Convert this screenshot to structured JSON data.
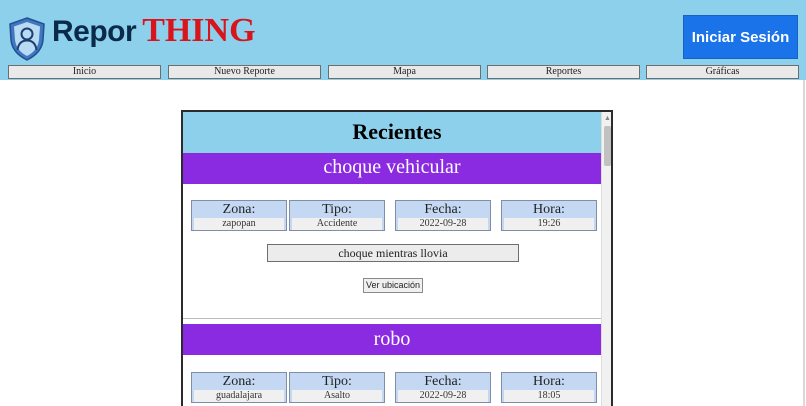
{
  "header": {
    "brand_part1": "Repor",
    "brand_part2": "THING",
    "login_label": "Iniciar Sesión",
    "nav": [
      "Inicio",
      "Nuevo Reporte",
      "Mapa",
      "Reportes",
      "Gráficas"
    ]
  },
  "panel": {
    "title": "Recientes",
    "reports": [
      {
        "title": "choque vehicular",
        "fields": [
          {
            "label": "Zona:",
            "value": "zapopan"
          },
          {
            "label": "Tipo:",
            "value": "Accidente"
          },
          {
            "label": "Fecha:",
            "value": "2022-09-28"
          },
          {
            "label": "Hora:",
            "value": "19:26"
          }
        ],
        "description": "choque mientras llovia",
        "location_button": "Ver ubicación"
      },
      {
        "title": "robo",
        "fields": [
          {
            "label": "Zona:",
            "value": "guadalajara"
          },
          {
            "label": "Tipo:",
            "value": "Asalto"
          },
          {
            "label": "Fecha:",
            "value": "2022-09-28"
          },
          {
            "label": "Hora:",
            "value": "18:05"
          }
        ]
      }
    ]
  },
  "colors": {
    "header_bg": "#8dd0ec",
    "brand_dark": "#0b2a4a",
    "brand_red": "#d8151c",
    "login_bg": "#1a73e8",
    "report_title_bg": "#8a2be2",
    "field_bg": "#c4d8f3"
  },
  "icons": {
    "logo": "shield-person-icon"
  }
}
